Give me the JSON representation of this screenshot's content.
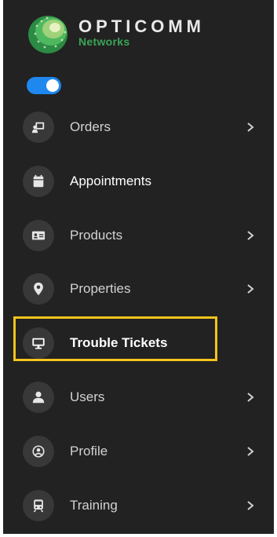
{
  "brand": {
    "name": "OPTICOMM",
    "subtitle": "Networks",
    "accent_color": "#3aa457"
  },
  "toggle": {
    "state": "on",
    "color": "#1e88ee"
  },
  "highlight_color": "#f5c41b",
  "nav": {
    "items": [
      {
        "label": "Orders",
        "icon": "orders-icon",
        "has_submenu": true
      },
      {
        "label": "Appointments",
        "icon": "calendar-icon",
        "has_submenu": false
      },
      {
        "label": "Products",
        "icon": "id-card-icon",
        "has_submenu": true
      },
      {
        "label": "Properties",
        "icon": "map-pin-icon",
        "has_submenu": true
      },
      {
        "label": "Trouble Tickets",
        "icon": "monitor-icon",
        "has_submenu": false,
        "highlighted": true
      },
      {
        "label": "Users",
        "icon": "user-icon",
        "has_submenu": true
      },
      {
        "label": "Profile",
        "icon": "profile-icon",
        "has_submenu": true
      },
      {
        "label": "Training",
        "icon": "train-icon",
        "has_submenu": true
      }
    ]
  }
}
